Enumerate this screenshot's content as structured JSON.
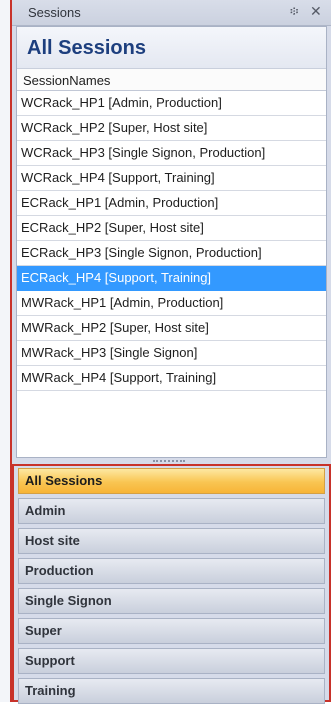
{
  "panel": {
    "title": "Sessions",
    "pin_glyph": "፨",
    "close_glyph": "✕"
  },
  "heading": "All Sessions",
  "column_header": "SessionNames",
  "sessions": [
    "WCRack_HP1 [Admin, Production]",
    "WCRack_HP2 [Super, Host site]",
    "WCRack_HP3 [Single Signon, Production]",
    "WCRack_HP4 [Support, Training]",
    "ECRack_HP1 [Admin, Production]",
    "ECRack_HP2 [Super, Host site]",
    "ECRack_HP3 [Single Signon, Production]",
    "ECRack_HP4 [Support, Training]",
    "MWRack_HP1 [Admin, Production]",
    "MWRack_HP2 [Super, Host site]",
    "MWRack_HP3 [Single Signon]",
    "MWRack_HP4 [Support, Training]"
  ],
  "selected_session": "ECRack_HP4 [Support, Training]",
  "nav": [
    "All Sessions",
    "Admin",
    "Host site",
    "Production",
    "Single Signon",
    "Super",
    "Support",
    "Training"
  ],
  "active_nav": "All Sessions",
  "colors": {
    "selection": "#3399ff",
    "heading": "#1d3f7e",
    "highlight_border": "#c8322a",
    "active_nav": "#f9c552"
  }
}
